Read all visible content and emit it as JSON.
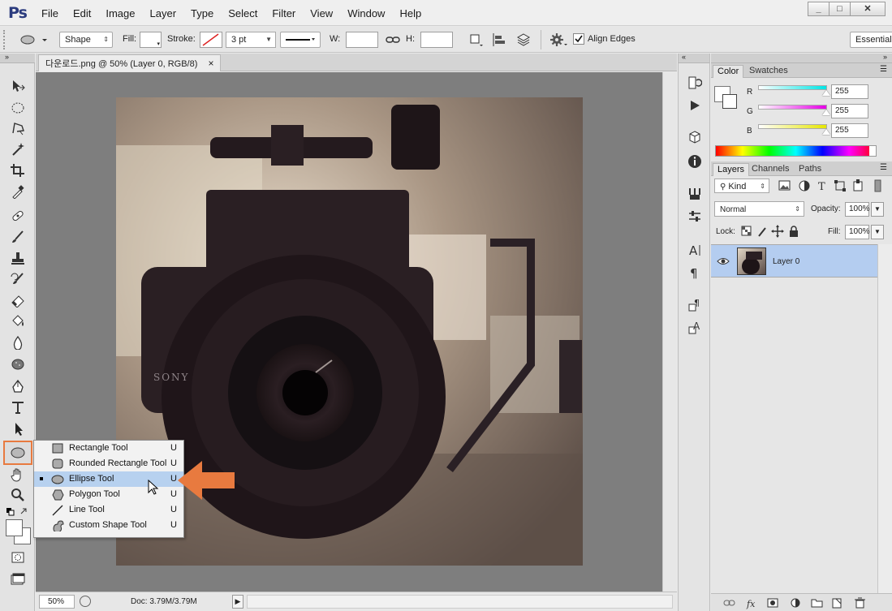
{
  "app": {
    "logo": "Ps",
    "menus": [
      "File",
      "Edit",
      "Image",
      "Layer",
      "Type",
      "Select",
      "Filter",
      "View",
      "Window",
      "Help"
    ],
    "window_controls": [
      "_",
      "□",
      "✕"
    ]
  },
  "options": {
    "shape_mode": "Shape",
    "fill_label": "Fill:",
    "stroke_label": "Stroke:",
    "stroke_size": "3 pt",
    "w_label": "W:",
    "h_label": "H:",
    "align_edges_label": "Align Edges",
    "workspace": "Essential"
  },
  "document": {
    "tab_title": "다운로드.png @ 50% (Layer 0, RGB/8)",
    "tab_close": "×",
    "zoom": "50%",
    "doc_size": "Doc: 3.79M/3.79M"
  },
  "flyout": {
    "items": [
      {
        "label": "Rectangle Tool",
        "key": "U",
        "icon": "rectangle-icon"
      },
      {
        "label": "Rounded Rectangle Tool",
        "key": "U",
        "icon": "rounded-rectangle-icon"
      },
      {
        "label": "Ellipse Tool",
        "key": "U",
        "icon": "ellipse-icon",
        "selected": true
      },
      {
        "label": "Polygon Tool",
        "key": "U",
        "icon": "polygon-icon"
      },
      {
        "label": "Line Tool",
        "key": "U",
        "icon": "line-icon"
      },
      {
        "label": "Custom Shape Tool",
        "key": "U",
        "icon": "custom-shape-icon"
      }
    ]
  },
  "color_panel": {
    "tabs": [
      "Color",
      "Swatches"
    ],
    "channels": [
      {
        "label": "R",
        "value": "255",
        "color": "#00e5e5"
      },
      {
        "label": "G",
        "value": "255",
        "color": "#e600e6"
      },
      {
        "label": "B",
        "value": "255",
        "color": "#e6e600"
      }
    ]
  },
  "layers_panel": {
    "tabs": [
      "Layers",
      "Channels",
      "Paths"
    ],
    "kind_label": "Kind",
    "blend_mode": "Normal",
    "opacity_label": "Opacity:",
    "opacity_value": "100%",
    "lock_label": "Lock:",
    "fill_label": "Fill:",
    "fill_value": "100%",
    "layers": [
      {
        "name": "Layer 0",
        "visible": true
      }
    ]
  },
  "colors": {
    "accent_orange": "#e87a3f",
    "selection_blue": "#b7d1ef",
    "layer_selected": "#b4cdf0"
  }
}
